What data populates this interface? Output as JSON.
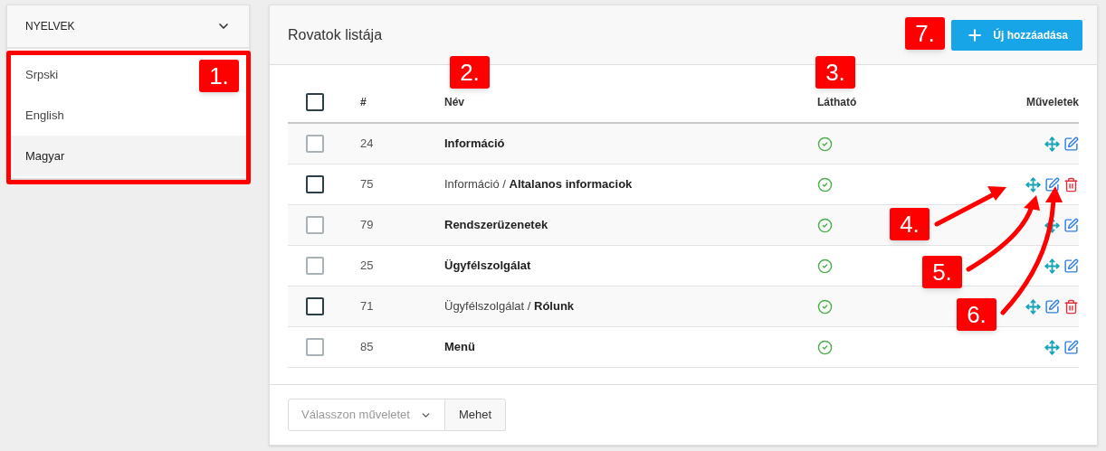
{
  "languages": {
    "title": "NYELVEK",
    "items": [
      {
        "label": "Srpski",
        "selected": false
      },
      {
        "label": "English",
        "selected": false
      },
      {
        "label": "Magyar",
        "selected": true
      }
    ]
  },
  "panel": {
    "title": "Rovatok listája",
    "add_button": "Új hozzáadása"
  },
  "table": {
    "columns": [
      "#",
      "Név",
      "Látható",
      "Műveletek"
    ],
    "select_all_disabled": false,
    "rows": [
      {
        "id": "24",
        "kind": "root",
        "name": "Információ",
        "visible": true,
        "checkbox_disabled": true,
        "deletable": false
      },
      {
        "id": "75",
        "kind": "child",
        "name": "Információ / **Altalanos informaciok**",
        "visible": true,
        "checkbox_disabled": false,
        "deletable": true
      },
      {
        "id": "79",
        "kind": "root",
        "name": "Rendszerüzenetek",
        "visible": true,
        "checkbox_disabled": true,
        "deletable": false
      },
      {
        "id": "25",
        "kind": "root",
        "name": "Ügyfélszolgálat",
        "visible": true,
        "checkbox_disabled": true,
        "deletable": false
      },
      {
        "id": "71",
        "kind": "child",
        "name": "Ügyfélszolgálat / **Rólunk**",
        "visible": true,
        "checkbox_disabled": false,
        "deletable": true
      },
      {
        "id": "85",
        "kind": "root",
        "name": "Menü",
        "visible": true,
        "checkbox_disabled": true,
        "deletable": false
      }
    ]
  },
  "footer": {
    "action_select": {
      "placeholder": "Válasszon műveletet"
    },
    "go_button": "Mehet"
  },
  "callouts": [
    "1.",
    "2.",
    "3.",
    "4.",
    "5.",
    "6.",
    "7."
  ]
}
